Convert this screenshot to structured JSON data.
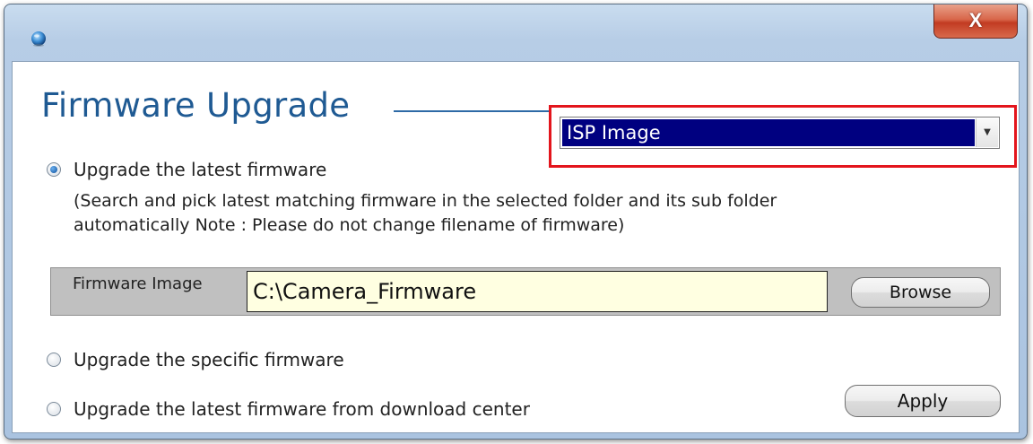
{
  "window": {
    "icon": "globe-icon",
    "close_label": "X"
  },
  "heading": "Firmware Upgrade",
  "image_type": {
    "selected": "ISP Image"
  },
  "options": [
    {
      "label": "Upgrade the latest firmware",
      "checked": true
    },
    {
      "label": "Upgrade the specific firmware",
      "checked": false
    },
    {
      "label": "Upgrade the latest firmware from download center",
      "checked": false
    }
  ],
  "note": {
    "line1": "(Search and pick latest matching firmware in the selected folder and its sub folder",
    "line2": "automatically Note : Please do not change filename of firmware)"
  },
  "firmware_image": {
    "label": "Firmware Image",
    "value": "C:\\Camera_Firmware",
    "browse_label": "Browse"
  },
  "apply_label": "Apply",
  "colors": {
    "heading": "#1f5a93",
    "highlight_border": "#e3151c",
    "select_bg": "#000080",
    "input_bg": "#ffffe1"
  }
}
